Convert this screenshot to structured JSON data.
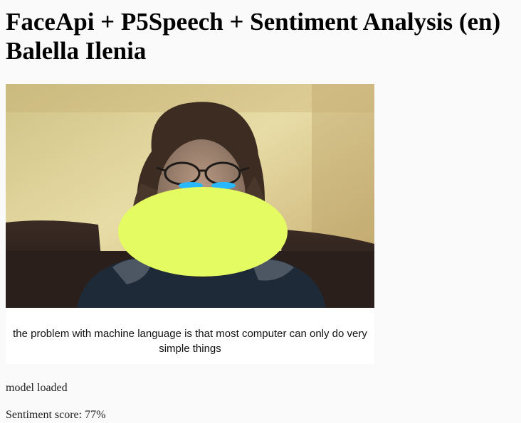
{
  "page": {
    "title_line1": "FaceApi + P5Speech + Sentiment Analysis (en)",
    "title_line2": "Balella Ilenia"
  },
  "camera": {
    "overlay_color": "#e4fb62",
    "eye_color": "#28b8ff"
  },
  "speech": {
    "transcript": "the problem with machine language is that most computer can only do very simple things"
  },
  "status": {
    "model_message": "model loaded",
    "sentiment_label": "Sentiment score:",
    "sentiment_value": "77%"
  }
}
